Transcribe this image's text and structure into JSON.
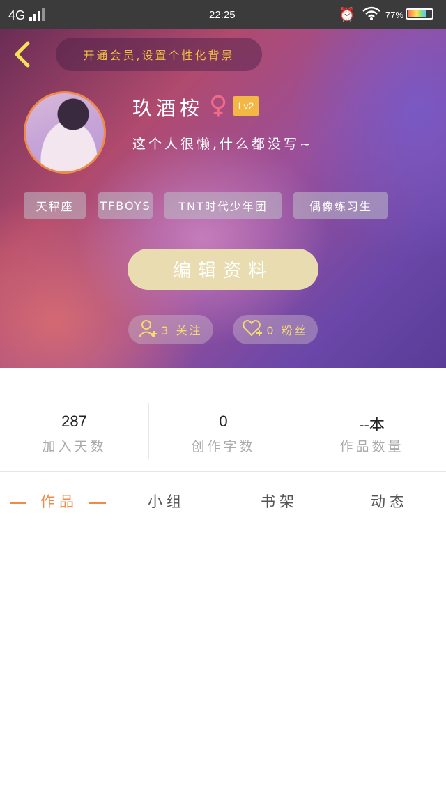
{
  "status_bar": {
    "network": "4G",
    "time": "22:25",
    "battery": "77%",
    "battery_level": 0.77,
    "icons": [
      "signal-icon",
      "alarm-icon",
      "wifi-icon",
      "battery-icon"
    ]
  },
  "header": {
    "back_icon": "back-arrow-icon",
    "vip_banner": "开通会员,设置个性化背景",
    "username": "玖酒桉",
    "gender_symbol": "♀",
    "level": "Lv2",
    "bio": "这个人很懒,什么都没写~",
    "tags": [
      "天秤座",
      "TFBOYS",
      "TNT时代少年团",
      "偶像练习生"
    ],
    "edit_button": "编辑资料",
    "follow_label": "3 关注",
    "fans_label": "0 粉丝",
    "colors": {
      "accent_yellow": "#f3dc70",
      "level_badge": "#f2b744",
      "edit_button": "#e8dcb0"
    }
  },
  "stats": [
    {
      "value": "287",
      "label": "加入天数"
    },
    {
      "value": "0",
      "label": "创作字数"
    },
    {
      "value": "--本",
      "label": "作品数量"
    }
  ],
  "tabs": [
    {
      "label": "作品",
      "active": true
    },
    {
      "label": "小组",
      "active": false
    },
    {
      "label": "书架",
      "active": false
    },
    {
      "label": "动态",
      "active": false
    }
  ],
  "accent_color": "#f0894a"
}
